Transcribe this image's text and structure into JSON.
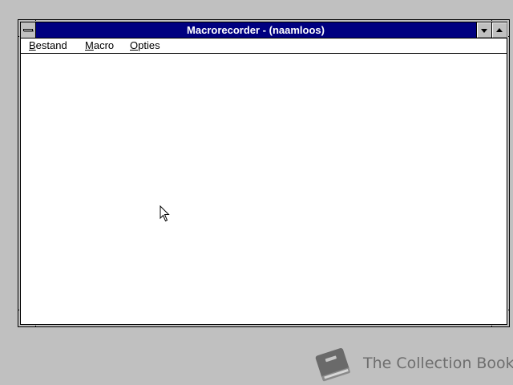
{
  "window": {
    "title": "Macrorecorder - (naamloos)"
  },
  "menubar": {
    "items": [
      {
        "accel": "B",
        "rest": "estand"
      },
      {
        "accel": "M",
        "rest": "acro"
      },
      {
        "accel": "O",
        "rest": "pties"
      }
    ]
  },
  "icons": {
    "system_menu": "system-menu-icon",
    "minimize": "minimize-arrow-icon",
    "maximize": "maximize-arrow-icon",
    "cursor": "mouse-pointer-icon",
    "watermark_logo": "book-icon"
  },
  "watermark": {
    "text": "The Collection Book"
  },
  "colors": {
    "titlebar": "#000080",
    "desktop": "#c0c0c0",
    "client": "#ffffff"
  }
}
